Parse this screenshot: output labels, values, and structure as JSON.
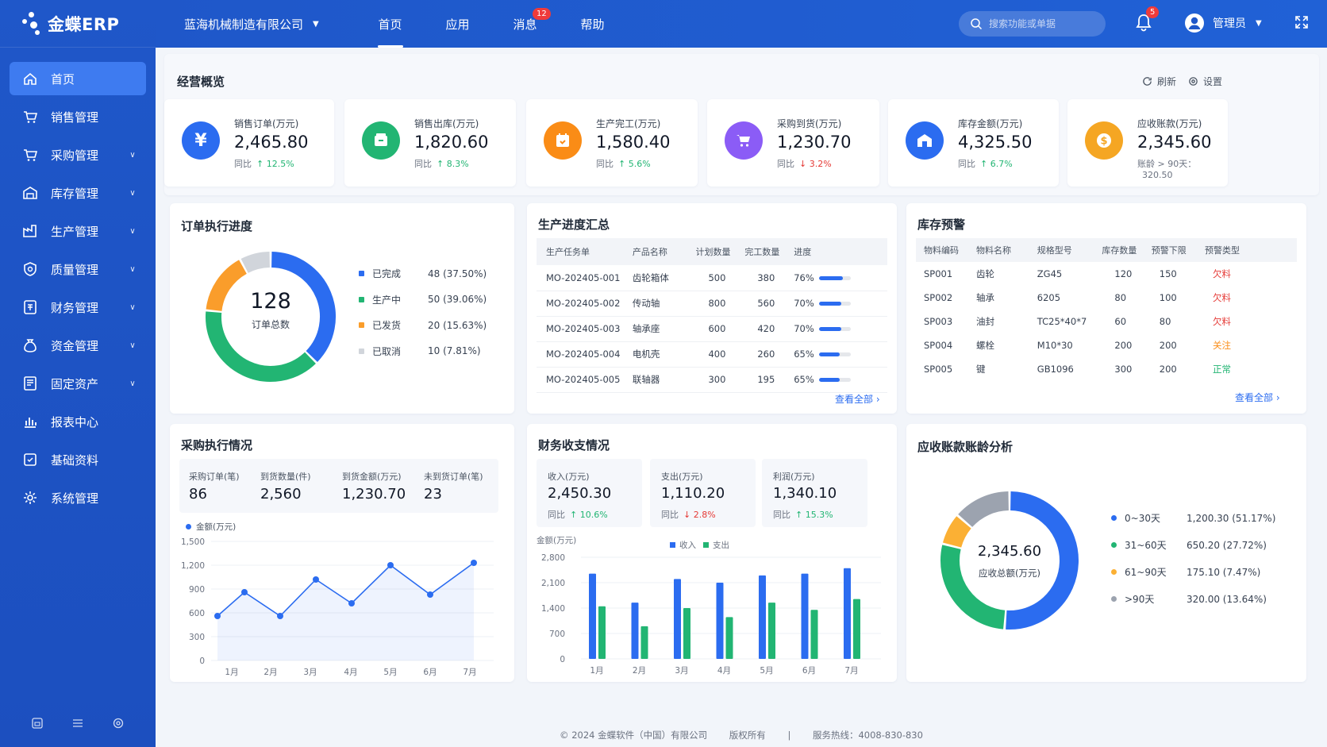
{
  "app": {
    "logo_text": "金蝶ERP"
  },
  "sidebar": {
    "items": [
      {
        "label": "首页",
        "icon": "home-icon",
        "active": true,
        "chevron": false
      },
      {
        "label": "销售管理",
        "icon": "cart-icon",
        "chevron": false
      },
      {
        "label": "采购管理",
        "icon": "cart-icon",
        "chevron": true
      },
      {
        "label": "库存管理",
        "icon": "warehouse-icon",
        "chevron": true
      },
      {
        "label": "生产管理",
        "icon": "factory-icon",
        "chevron": true
      },
      {
        "label": "质量管理",
        "icon": "shield-icon",
        "chevron": true
      },
      {
        "label": "财务管理",
        "icon": "finance-icon",
        "chevron": true
      },
      {
        "label": "资金管理",
        "icon": "money-bag-icon",
        "chevron": true
      },
      {
        "label": "固定资产",
        "icon": "asset-icon",
        "chevron": true
      },
      {
        "label": "报表中心",
        "icon": "bar-chart-icon",
        "chevron": false
      },
      {
        "label": "基础资料",
        "icon": "data-icon",
        "chevron": false
      },
      {
        "label": "系统管理",
        "icon": "gear-icon",
        "chevron": false
      }
    ]
  },
  "header": {
    "company": "蓝海机械制造有限公司",
    "tabs": [
      {
        "label": "首页",
        "active": true
      },
      {
        "label": "应用"
      },
      {
        "label": "消息",
        "badge": "12"
      },
      {
        "label": "帮助"
      }
    ],
    "search_placeholder": "搜索功能或单据",
    "bell_badge": "5",
    "user": "管理员"
  },
  "overview": {
    "title": "经营概览",
    "refresh": "刷新",
    "settings": "设置",
    "kpis": [
      {
        "label": "销售订单(万元)",
        "value": "2,465.80",
        "cmp": "同比",
        "delta": "↑ 12.5%",
        "dir": "up",
        "color": "#2b6cf0",
        "icon": "yen-icon"
      },
      {
        "label": "销售出库(万元)",
        "value": "1,820.60",
        "cmp": "同比",
        "delta": "↑ 8.3%",
        "dir": "up",
        "color": "#22b573",
        "icon": "box-out-icon"
      },
      {
        "label": "生产完工(万元)",
        "value": "1,580.40",
        "cmp": "同比",
        "delta": "↑ 5.6%",
        "dir": "up",
        "color": "#fa8c16",
        "icon": "calendar-icon"
      },
      {
        "label": "采购到货(万元)",
        "value": "1,230.70",
        "cmp": "同比",
        "delta": "↓ 3.2%",
        "dir": "down",
        "color": "#8b5cf6",
        "icon": "cart-icon"
      },
      {
        "label": "库存金额(万元)",
        "value": "4,325.50",
        "cmp": "同比",
        "delta": "↑ 6.7%",
        "dir": "up",
        "color": "#2b6cf0",
        "icon": "warehouse-icon"
      },
      {
        "label": "应收账款(万元)",
        "value": "2,345.60",
        "cmp": "账龄 > 90天：",
        "delta": "320.50",
        "dir": "none",
        "color": "#f5a623",
        "icon": "coin-icon"
      }
    ]
  },
  "order_progress": {
    "title": "订单执行进度",
    "total": "128",
    "total_label": "订单总数",
    "segments": [
      {
        "name": "已完成",
        "value": 48,
        "text": "48 (37.50%)",
        "color": "#2b6cf0"
      },
      {
        "name": "生产中",
        "value": 50,
        "text": "50 (39.06%)",
        "color": "#22b573"
      },
      {
        "name": "已发货",
        "value": 20,
        "text": "20 (15.63%)",
        "color": "#fa9d2b"
      },
      {
        "name": "已取消",
        "value": 10,
        "text": "10 (7.81%)",
        "color": "#d1d5db"
      }
    ]
  },
  "production": {
    "title": "生产进度汇总",
    "columns": [
      "生产任务单",
      "产品名称",
      "计划数量",
      "完工数量",
      "进度"
    ],
    "rows": [
      {
        "no": "MO-202405-001",
        "product": "齿轮箱体",
        "plan": "500",
        "done": "380",
        "pct": "76%",
        "frac": 0.76
      },
      {
        "no": "MO-202405-002",
        "product": "传动轴",
        "plan": "800",
        "done": "560",
        "pct": "70%",
        "frac": 0.7
      },
      {
        "no": "MO-202405-003",
        "product": "轴承座",
        "plan": "600",
        "done": "420",
        "pct": "70%",
        "frac": 0.7
      },
      {
        "no": "MO-202405-004",
        "product": "电机壳",
        "plan": "400",
        "done": "260",
        "pct": "65%",
        "frac": 0.65
      },
      {
        "no": "MO-202405-005",
        "product": "联轴器",
        "plan": "300",
        "done": "195",
        "pct": "65%",
        "frac": 0.65
      }
    ],
    "more": "查看全部 ›"
  },
  "inventory": {
    "title": "库存预警",
    "columns": [
      "物料编码",
      "物料名称",
      "规格型号",
      "库存数量",
      "预警下限",
      "预警类型"
    ],
    "rows": [
      {
        "code": "SP001",
        "name": "齿轮",
        "spec": "ZG45",
        "qty": "120",
        "min": "150",
        "type": "欠料",
        "color": "#e53935"
      },
      {
        "code": "SP002",
        "name": "轴承",
        "spec": "6205",
        "qty": "80",
        "min": "100",
        "type": "欠料",
        "color": "#e53935"
      },
      {
        "code": "SP003",
        "name": "油封",
        "spec": "TC25*40*7",
        "qty": "60",
        "min": "80",
        "type": "欠料",
        "color": "#e53935"
      },
      {
        "code": "SP004",
        "name": "螺栓",
        "spec": "M10*30",
        "qty": "200",
        "min": "200",
        "type": "关注",
        "color": "#fa8c16"
      },
      {
        "code": "SP005",
        "name": "键",
        "spec": "GB1096",
        "qty": "300",
        "min": "200",
        "type": "正常",
        "color": "#22b573"
      }
    ],
    "more": "查看全部 ›"
  },
  "purchase": {
    "title": "采购执行情况",
    "stats": [
      {
        "label": "采购订单(笔)",
        "value": "86"
      },
      {
        "label": "到货数量(件)",
        "value": "2,560"
      },
      {
        "label": "到货金额(万元)",
        "value": "1,230.70"
      },
      {
        "label": "未到货订单(笔)",
        "value": "23"
      }
    ],
    "legend": "金额(万元)"
  },
  "finance": {
    "title": "财务收支情况",
    "stats": [
      {
        "label": "收入(万元)",
        "value": "2,450.30",
        "cmp": "同比",
        "delta": "↑ 10.6%",
        "dir": "up"
      },
      {
        "label": "支出(万元)",
        "value": "1,110.20",
        "cmp": "同比",
        "delta": "↓ 2.8%",
        "dir": "down"
      },
      {
        "label": "利润(万元)",
        "value": "1,340.10",
        "cmp": "同比",
        "delta": "↑ 15.3%",
        "dir": "up"
      }
    ],
    "unit": "金额(万元)",
    "legend": [
      "收入",
      "支出"
    ]
  },
  "receivable": {
    "title": "应收账款账龄分析",
    "total": "2,345.60",
    "total_label": "应收总额(万元)",
    "segments": [
      {
        "name": "0~30天",
        "value": 1200.3,
        "text": "1,200.30 (51.17%)",
        "color": "#2b6cf0"
      },
      {
        "name": "31~60天",
        "value": 650.2,
        "text": "650.20 (27.72%)",
        "color": "#22b573"
      },
      {
        "name": "61~90天",
        "value": 175.1,
        "text": "175.10 (7.47%)",
        "color": "#fbb034"
      },
      {
        "name": ">90天",
        "value": 320.0,
        "text": "320.00 (13.64%)",
        "color": "#9ca3af"
      }
    ]
  },
  "chart_data": [
    {
      "type": "line",
      "title": "",
      "categories": [
        "1月",
        "2月",
        "3月",
        "4月",
        "5月",
        "6月",
        "7月"
      ],
      "series": [
        {
          "name": "金额(万元)",
          "values": [
            560,
            860,
            560,
            1020,
            720,
            1200,
            830,
            1230
          ]
        }
      ],
      "x_points": [
        "1月",
        "1.5",
        "2月",
        "3月",
        "4月",
        "5月",
        "6月",
        "7月"
      ],
      "ylim": [
        0,
        1500
      ],
      "yticks": [
        "0",
        "300",
        "600",
        "900",
        "1,200",
        "1,500"
      ],
      "grid": true,
      "color": "#2b6cf0"
    },
    {
      "type": "bar",
      "title": "",
      "ylabel": "金额(万元)",
      "categories": [
        "1月",
        "2月",
        "3月",
        "4月",
        "5月",
        "6月",
        "7月"
      ],
      "series": [
        {
          "name": "收入",
          "values": [
            2350,
            1550,
            2200,
            2100,
            2300,
            2350,
            2500
          ],
          "color": "#2b6cf0"
        },
        {
          "name": "支出",
          "values": [
            1450,
            900,
            1400,
            1150,
            1550,
            1350,
            1650
          ],
          "color": "#22b573"
        }
      ],
      "ylim": [
        0,
        2800
      ],
      "yticks": [
        "0",
        "700",
        "1,400",
        "2,100",
        "2,800"
      ],
      "grid": true
    },
    {
      "type": "pie",
      "title": "",
      "categories": [
        "已完成",
        "生产中",
        "已发货",
        "已取消"
      ],
      "values": [
        48,
        50,
        20,
        10
      ]
    },
    {
      "type": "pie",
      "title": "",
      "categories": [
        "0~30天",
        "31~60天",
        "61~90天",
        ">90天"
      ],
      "values": [
        1200.3,
        650.2,
        175.1,
        320.0
      ]
    }
  ],
  "footer": {
    "copyright": "© 2024 金蝶软件（中国）有限公司",
    "rights": "版权所有",
    "sep": "|",
    "hotline": "服务热线：4008-830-830"
  }
}
